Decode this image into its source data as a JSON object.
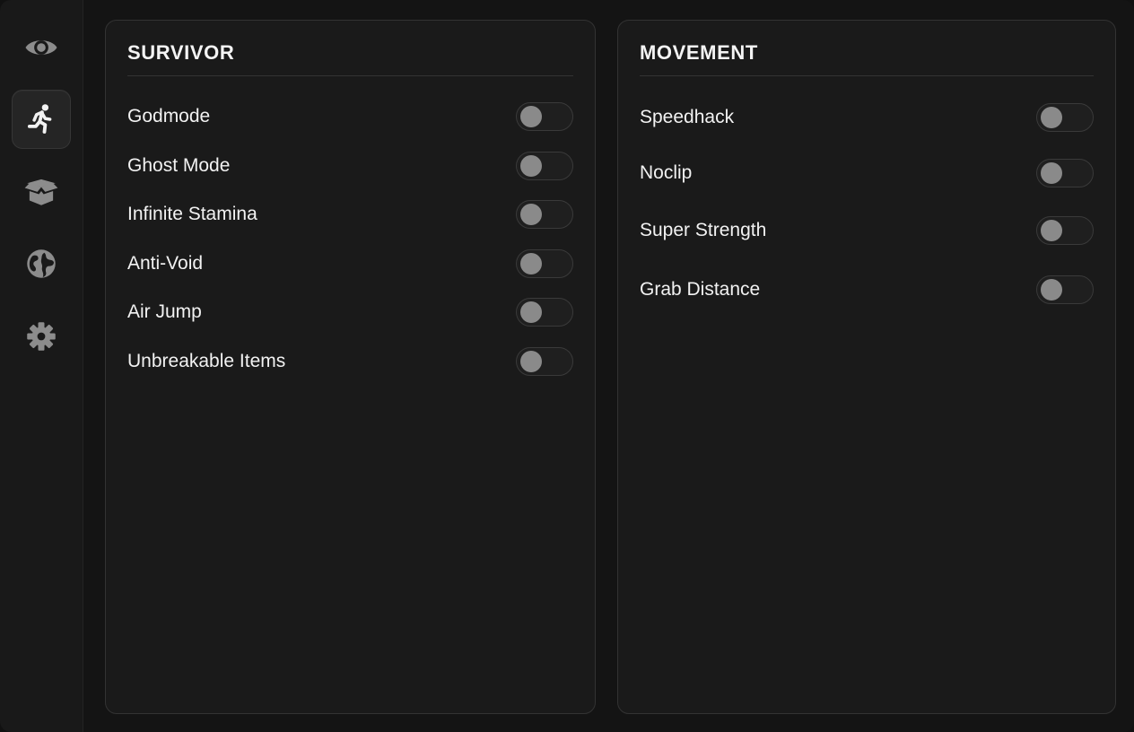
{
  "sidebar": {
    "items": [
      {
        "icon": "eye-icon",
        "active": false
      },
      {
        "icon": "running-person-icon",
        "active": true
      },
      {
        "icon": "box-icon",
        "active": false
      },
      {
        "icon": "globe-icon",
        "active": false
      },
      {
        "icon": "gear-icon",
        "active": false
      }
    ]
  },
  "colors": {
    "background": "#141414",
    "panel": "#1a1a1a",
    "panel_border": "#333333",
    "active_item": "#252525",
    "icon": "#8c8c8c",
    "toggle_knob_off": "#8a8a8a",
    "text": "#f2f2f2"
  },
  "survivor": {
    "title": "SURVIVOR",
    "options": [
      {
        "label": "Godmode",
        "enabled": false
      },
      {
        "label": "Ghost Mode",
        "enabled": false
      },
      {
        "label": "Infinite Stamina",
        "enabled": false
      },
      {
        "label": "Anti-Void",
        "enabled": false
      },
      {
        "label": "Air Jump",
        "enabled": false
      },
      {
        "label": "Unbreakable Items",
        "enabled": false
      }
    ]
  },
  "movement": {
    "title": "MOVEMENT",
    "options": [
      {
        "label": "Speedhack",
        "enabled": false
      },
      {
        "label": "Noclip",
        "enabled": false
      },
      {
        "label": "Super Strength",
        "enabled": false
      },
      {
        "label": "Grab Distance",
        "enabled": false
      }
    ]
  }
}
